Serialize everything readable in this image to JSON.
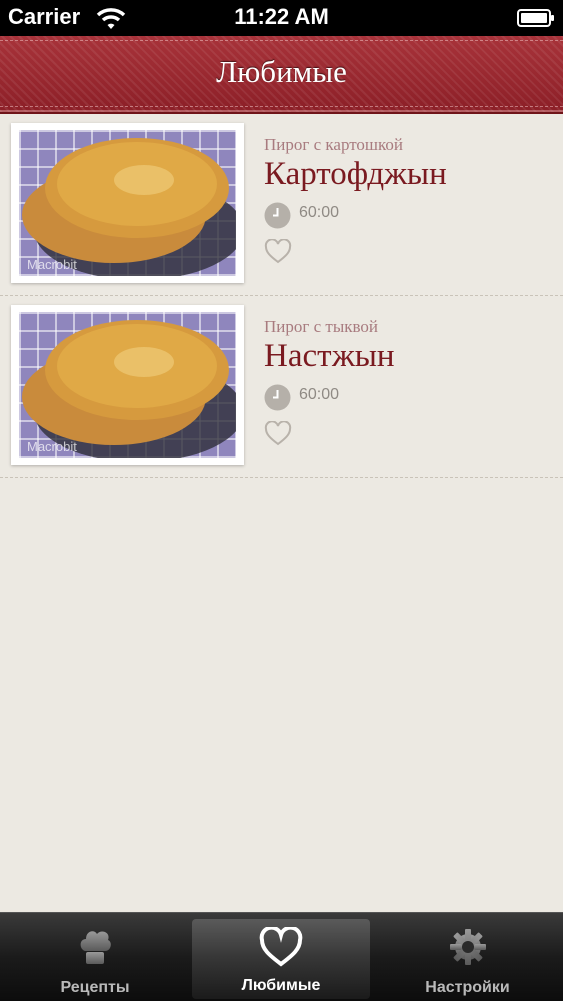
{
  "status_bar": {
    "carrier": "Carrier",
    "time": "11:22 AM"
  },
  "nav": {
    "title": "Любимые"
  },
  "recipes": [
    {
      "subtitle": "Пирог с картошкой",
      "title": "Картофджын",
      "time": "60:00",
      "watermark": "Macrobit"
    },
    {
      "subtitle": "Пирог с тыквой",
      "title": "Настжын",
      "time": "60:00",
      "watermark": "Macrobit"
    }
  ],
  "tabs": [
    {
      "label": "Рецепты",
      "icon": "chef-hat-icon"
    },
    {
      "label": "Любимые",
      "icon": "heart-icon"
    },
    {
      "label": "Настройки",
      "icon": "gear-icon"
    }
  ],
  "colors": {
    "nav_red": "#9a2a31",
    "title_red": "#7a1a20",
    "background": "#ece9e2"
  }
}
